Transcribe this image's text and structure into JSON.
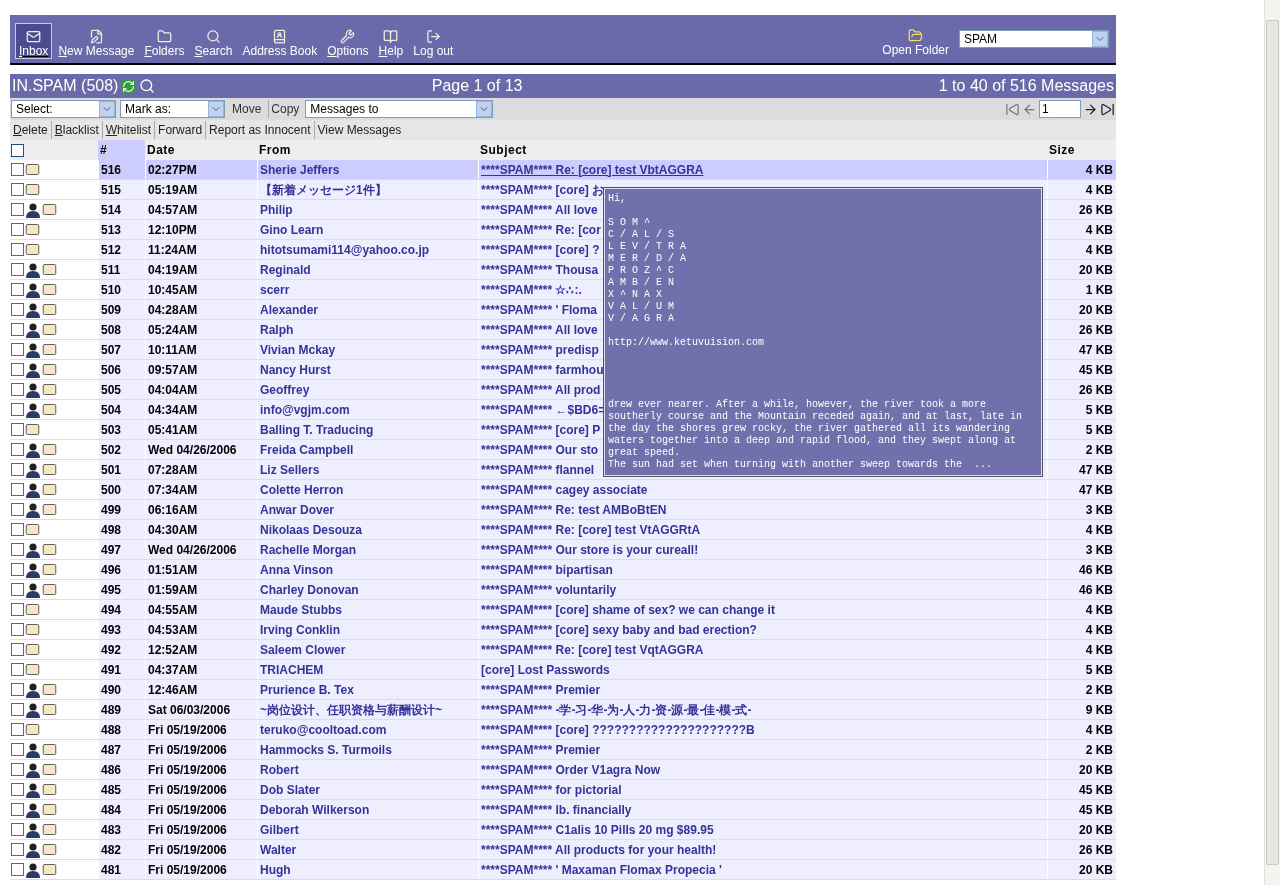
{
  "toolbar": {
    "items": [
      {
        "label": "Inbox",
        "shortcut": true,
        "selected": true
      },
      {
        "label": "New Message",
        "shortcut": true,
        "selected": false
      },
      {
        "label": "Folders",
        "shortcut": true,
        "selected": false
      },
      {
        "label": "Search",
        "shortcut": true,
        "selected": false
      },
      {
        "label": "Address Book",
        "shortcut": false,
        "selected": false
      },
      {
        "label": "Options",
        "shortcut": true,
        "selected": false
      },
      {
        "label": "Help",
        "shortcut": true,
        "selected": false
      },
      {
        "label": "Log out",
        "shortcut": false,
        "selected": false
      }
    ],
    "open_folder": {
      "label": "Open Folder",
      "value": "SPAM"
    }
  },
  "title_bar": {
    "folder": "IN.SPAM (508)",
    "page": "Page 1 of 13",
    "range": "1 to 40 of 516 Messages"
  },
  "controls": {
    "select": "Select:",
    "mark_as": "Mark as:",
    "move": "Move",
    "copy": "Copy",
    "target": "Messages to",
    "page_value": "1"
  },
  "actions": [
    {
      "label": "Delete",
      "shortcut": true
    },
    {
      "label": "Blacklist",
      "shortcut": true
    },
    {
      "label": "Whitelist",
      "shortcut": true
    },
    {
      "label": "Forward",
      "shortcut": false
    },
    {
      "label": "Report as Innocent",
      "shortcut": false
    },
    {
      "label": "View Messages",
      "shortcut": false
    }
  ],
  "table": {
    "select_all_checked": false,
    "columns": [
      {
        "label": "#",
        "sorted": true
      },
      {
        "label": "Date",
        "sorted": false
      },
      {
        "label": "From",
        "sorted": false
      },
      {
        "label": "Subject",
        "sorted": false
      },
      {
        "label": "Size",
        "sorted": false
      }
    ],
    "rows": [
      {
        "num": "516",
        "date": "02:27PM",
        "from": "Sherie Jeffers",
        "subject": "****SPAM**** Re: [core] test VbtAGGRA",
        "size": "4 KB",
        "contact": false,
        "checked": false,
        "selected": true
      },
      {
        "num": "515",
        "date": "05:19AM",
        "from": "【新着メッセージ1件】",
        "subject": "****SPAM**** [core] お",
        "size": "4 KB",
        "contact": false,
        "checked": false,
        "selected": false
      },
      {
        "num": "514",
        "date": "04:57AM",
        "from": "Philip",
        "subject": "****SPAM**** All love",
        "size": "26 KB",
        "contact": true,
        "checked": false,
        "selected": false
      },
      {
        "num": "513",
        "date": "12:10PM",
        "from": "Gino Learn",
        "subject": "****SPAM**** Re: [cor",
        "size": "4 KB",
        "contact": false,
        "checked": false,
        "selected": false
      },
      {
        "num": "512",
        "date": "11:24AM",
        "from": "hitotsumami114@yahoo.co.jp",
        "subject": "****SPAM**** [core] ?",
        "size": "4 KB",
        "contact": false,
        "checked": false,
        "selected": false
      },
      {
        "num": "511",
        "date": "04:19AM",
        "from": "Reginald",
        "subject": "****SPAM**** Thousa",
        "size": "20 KB",
        "contact": true,
        "checked": false,
        "selected": false
      },
      {
        "num": "510",
        "date": "10:45AM",
        "from": "scerr",
        "subject": "****SPAM**** ☆∴:.",
        "size": "1 KB",
        "contact": true,
        "checked": false,
        "selected": false
      },
      {
        "num": "509",
        "date": "04:28AM",
        "from": "Alexander",
        "subject": "****SPAM**** ' Floma",
        "size": "20 KB",
        "contact": true,
        "checked": false,
        "selected": false
      },
      {
        "num": "508",
        "date": "05:24AM",
        "from": "Ralph",
        "subject": "****SPAM**** All love",
        "size": "26 KB",
        "contact": true,
        "checked": false,
        "selected": false
      },
      {
        "num": "507",
        "date": "10:11AM",
        "from": "Vivian Mckay",
        "subject": "****SPAM**** predisp",
        "size": "47 KB",
        "contact": true,
        "checked": false,
        "selected": false
      },
      {
        "num": "506",
        "date": "09:57AM",
        "from": "Nancy Hurst",
        "subject": "****SPAM**** farmhou",
        "size": "45 KB",
        "contact": true,
        "checked": false,
        "selected": false
      },
      {
        "num": "505",
        "date": "04:04AM",
        "from": "Geoffrey",
        "subject": "****SPAM**** All prod",
        "size": "26 KB",
        "contact": true,
        "checked": false,
        "selected": false
      },
      {
        "num": "504",
        "date": "04:34AM",
        "from": "info@vgjm.com",
        "subject": "****SPAM**** ←$BD6=",
        "size": "5 KB",
        "contact": true,
        "checked": false,
        "selected": false
      },
      {
        "num": "503",
        "date": "05:41AM",
        "from": "Balling T. Traducing",
        "subject": "****SPAM**** [core] P",
        "size": "5 KB",
        "contact": false,
        "checked": false,
        "selected": false
      },
      {
        "num": "502",
        "date": "Wed 04/26/2006",
        "from": "Freida Campbell",
        "subject": "****SPAM**** Our sto",
        "size": "2 KB",
        "contact": true,
        "checked": false,
        "selected": false
      },
      {
        "num": "501",
        "date": "07:28AM",
        "from": "Liz Sellers",
        "subject": "****SPAM**** flannel",
        "size": "47 KB",
        "contact": true,
        "checked": false,
        "selected": false
      },
      {
        "num": "500",
        "date": "07:34AM",
        "from": "Colette Herron",
        "subject": "****SPAM**** cagey associate",
        "size": "47 KB",
        "contact": true,
        "checked": false,
        "selected": false
      },
      {
        "num": "499",
        "date": "06:16AM",
        "from": "Anwar Dover",
        "subject": "****SPAM**** Re: test AMBoBtEN",
        "size": "3 KB",
        "contact": true,
        "checked": false,
        "selected": false
      },
      {
        "num": "498",
        "date": "04:30AM",
        "from": "Nikolaas Desouza",
        "subject": "****SPAM**** Re: [core] test VtAGGRtA",
        "size": "4 KB",
        "contact": false,
        "checked": false,
        "selected": false
      },
      {
        "num": "497",
        "date": "Wed 04/26/2006",
        "from": "Rachelle Morgan",
        "subject": "****SPAM**** Our store is your cureall!",
        "size": "3 KB",
        "contact": true,
        "checked": false,
        "selected": false
      },
      {
        "num": "496",
        "date": "01:51AM",
        "from": "Anna Vinson",
        "subject": "****SPAM**** bipartisan",
        "size": "46 KB",
        "contact": true,
        "checked": false,
        "selected": false
      },
      {
        "num": "495",
        "date": "01:59AM",
        "from": "Charley Donovan",
        "subject": "****SPAM**** voluntarily",
        "size": "46 KB",
        "contact": true,
        "checked": false,
        "selected": false
      },
      {
        "num": "494",
        "date": "04:55AM",
        "from": "Maude Stubbs",
        "subject": "****SPAM**** [core] shame of sex? we can change it",
        "size": "4 KB",
        "contact": false,
        "checked": false,
        "selected": false
      },
      {
        "num": "493",
        "date": "04:53AM",
        "from": "Irving Conklin",
        "subject": "****SPAM**** [core] sexy baby and bad erection?",
        "size": "4 KB",
        "contact": false,
        "checked": false,
        "selected": false
      },
      {
        "num": "492",
        "date": "12:52AM",
        "from": "Saleem Clower",
        "subject": "****SPAM**** Re: [core] test VqtAGGRA",
        "size": "4 KB",
        "contact": false,
        "checked": false,
        "selected": false
      },
      {
        "num": "491",
        "date": "04:37AM",
        "from": "TRIACHEM",
        "subject": "[core] Lost Passwords",
        "size": "5 KB",
        "contact": false,
        "checked": false,
        "selected": false
      },
      {
        "num": "490",
        "date": "12:46AM",
        "from": "Prurience B. Tex",
        "subject": "****SPAM**** Premier",
        "size": "2 KB",
        "contact": true,
        "checked": false,
        "selected": false
      },
      {
        "num": "489",
        "date": "Sat 06/03/2006",
        "from": "~岗位设计、任职资格与薪酬设计~",
        "subject": "****SPAM**** -学-习-华-为-人-力-资-源-最-佳-模-式-",
        "size": "9 KB",
        "contact": true,
        "checked": false,
        "selected": false
      },
      {
        "num": "488",
        "date": "Fri 05/19/2006",
        "from": "teruko@cooltoad.com",
        "subject": "****SPAM**** [core] ?????????????????????B",
        "size": "4 KB",
        "contact": false,
        "checked": false,
        "selected": false
      },
      {
        "num": "487",
        "date": "Fri 05/19/2006",
        "from": "Hammocks S. Turmoils",
        "subject": "****SPAM**** Premier",
        "size": "2 KB",
        "contact": true,
        "checked": false,
        "selected": false
      },
      {
        "num": "486",
        "date": "Fri 05/19/2006",
        "from": "Robert",
        "subject": "****SPAM**** Order V1agra Now",
        "size": "20 KB",
        "contact": true,
        "checked": false,
        "selected": false
      },
      {
        "num": "485",
        "date": "Fri 05/19/2006",
        "from": "Dob Slater",
        "subject": "****SPAM**** for pictorial",
        "size": "45 KB",
        "contact": true,
        "checked": false,
        "selected": false
      },
      {
        "num": "484",
        "date": "Fri 05/19/2006",
        "from": "Deborah Wilkerson",
        "subject": "****SPAM**** lb. financially",
        "size": "45 KB",
        "contact": true,
        "checked": false,
        "selected": false
      },
      {
        "num": "483",
        "date": "Fri 05/19/2006",
        "from": "Gilbert",
        "subject": "****SPAM**** C1alis 10 Pills 20 mg $89.95",
        "size": "20 KB",
        "contact": true,
        "checked": false,
        "selected": false
      },
      {
        "num": "482",
        "date": "Fri 05/19/2006",
        "from": "Walter",
        "subject": "****SPAM**** All products for your health!",
        "size": "26 KB",
        "contact": true,
        "checked": false,
        "selected": false
      },
      {
        "num": "481",
        "date": "Fri 05/19/2006",
        "from": "Hugh",
        "subject": "****SPAM**** ' Maxaman Flomax Propecia '",
        "size": "20 KB",
        "contact": true,
        "checked": false,
        "selected": false
      }
    ]
  },
  "preview_tooltip": {
    "paragraphs": [
      "Hi,",
      "S O M ^\nC / A L / S\nL E V / T R A\nM E R / D / A\nP R O Z ^ C\nA M B / E N\nX ^ N A X\nV A L / U M\nV / A G R A",
      "http://www.ketuvuision.com",
      "drew ever nearer. After a while, however, the river took a more\nsoutherly course and the Mountain receded again, and at last, late in\nthe day the shores grew rocky, the river gathered all its wandering\nwaters together into a deep and rapid flood, and they swept along at\ngreat speed.\nThe sun had set when turning with another sweep towards the  ..."
    ]
  }
}
